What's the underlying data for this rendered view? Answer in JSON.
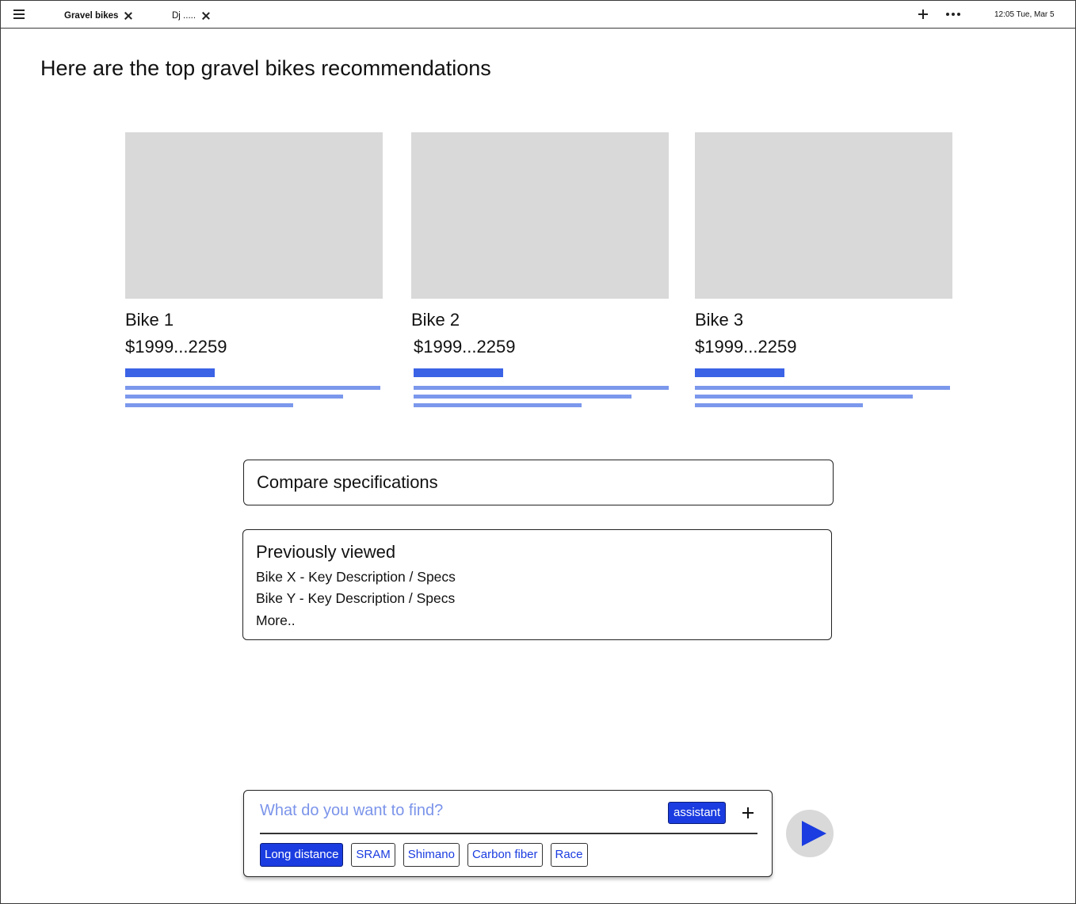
{
  "topbar": {
    "tabs": [
      {
        "label": "Gravel bikes",
        "active": true
      },
      {
        "label": "Dj .....",
        "active": false
      }
    ],
    "clock": "12:05 Tue, Mar 5"
  },
  "headline": "Here are the top gravel bikes recommendations",
  "cards": [
    {
      "name": "Bike 1",
      "price": "$1999...2259"
    },
    {
      "name": "Bike 2",
      "price": "$1999...2259"
    },
    {
      "name": "Bike 3",
      "price": "$1999...2259"
    }
  ],
  "compare": {
    "label": "Compare specifications"
  },
  "previously_viewed": {
    "title": "Previously viewed",
    "items": [
      "Bike X - Key Description / Specs",
      "Bike Y - Key Description / Specs",
      "More.."
    ]
  },
  "search": {
    "placeholder": "What do you want to find?",
    "assistant_label": "assistant",
    "chips": [
      {
        "label": "Long distance",
        "selected": true
      },
      {
        "label": "SRAM",
        "selected": false
      },
      {
        "label": "Shimano",
        "selected": false
      },
      {
        "label": "Carbon fiber",
        "selected": false
      },
      {
        "label": "Race",
        "selected": false
      }
    ]
  },
  "colors": {
    "accent": "#1a3ce0",
    "skeleton_bar": "#3b63e6",
    "skeleton_line": "#7b98ec",
    "image_placeholder": "#d9d9d9"
  }
}
